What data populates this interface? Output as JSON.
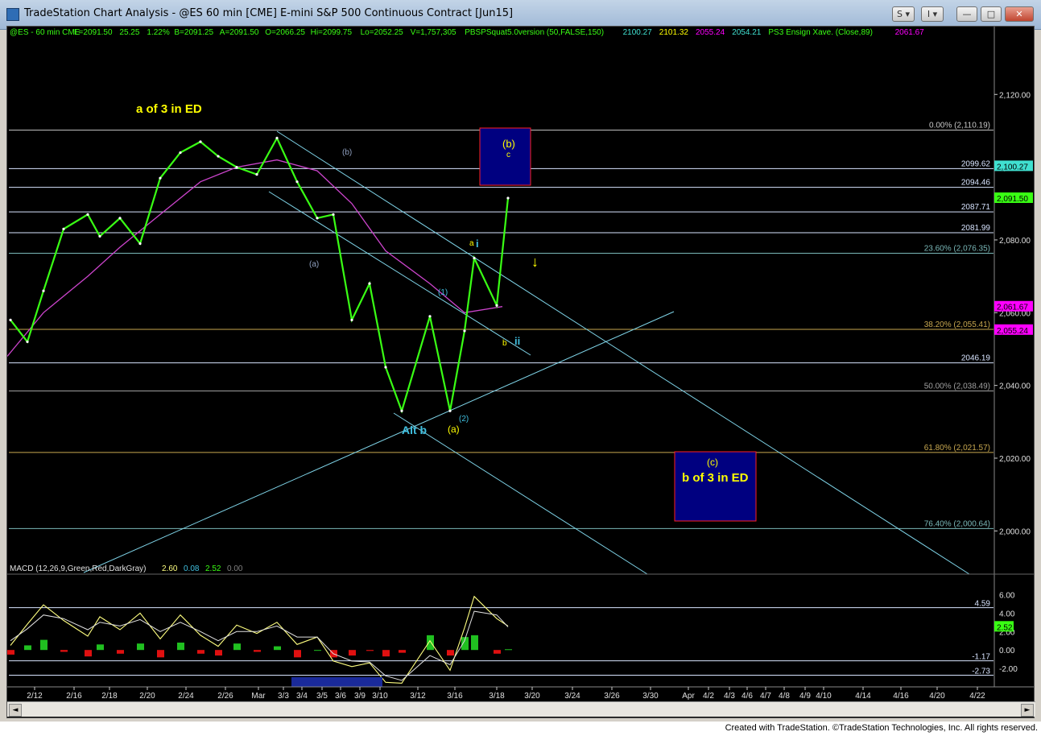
{
  "window": {
    "title": "TradeStation Chart Analysis - @ES 60 min [CME] E-mini S&P 500 Continuous Contract [Jun15]",
    "buttons": {
      "s": "S",
      "i": "I",
      "minimize": "—",
      "maximize": "□",
      "close": "✕"
    }
  },
  "header": {
    "symbol": "@ES - 60 min  CME",
    "items": [
      {
        "text": "L=2091.50",
        "color": "#39ff14"
      },
      {
        "text": "25.25",
        "color": "#39ff14"
      },
      {
        "text": "1.22%",
        "color": "#39ff14"
      },
      {
        "text": "B=2091.25",
        "color": "#39ff14"
      },
      {
        "text": "A=2091.50",
        "color": "#39ff14"
      },
      {
        "text": "O=2066.25",
        "color": "#39ff14"
      },
      {
        "text": "Hi=2099.75",
        "color": "#39ff14"
      },
      {
        "text": "Lo=2052.25",
        "color": "#39ff14"
      },
      {
        "text": "V=1,757,305",
        "color": "#39ff14"
      },
      {
        "text": "PBSPSquat5.0version (50,FALSE,150)",
        "color": "#39ff14"
      },
      {
        "text": "2100.27",
        "color": "#40e0d0"
      },
      {
        "text": "2101.32",
        "color": "#ffff00"
      },
      {
        "text": "2055.24",
        "color": "#ff00ff"
      },
      {
        "text": "2054.21",
        "color": "#40e0d0"
      },
      {
        "text": "PS3 Ensign Xave. (Close,89)",
        "color": "#39ff14"
      },
      {
        "text": "2061.67",
        "color": "#ff00ff"
      }
    ]
  },
  "chart_data": [
    {
      "type": "line",
      "title": "@ES 60 min E-mini S&P 500 Continuous Contract [Jun15]",
      "y_ticks": [
        2000,
        2020,
        2040,
        2060,
        2080,
        2100,
        2120
      ],
      "y_tick_labels": [
        "2,000.00",
        "2,020.00",
        "2,040.00",
        "2,060.00",
        "2,080.00",
        "2,100.00",
        "2,120.00"
      ],
      "ylim": [
        1989,
        2136
      ],
      "x_tick_labels": [
        "2/12",
        "2/16",
        "2/18",
        "2/20",
        "2/24",
        "2/26",
        "Mar",
        "3/3",
        "3/4",
        "3/5",
        "3/6",
        "3/9",
        "3/10",
        "3/12",
        "3/16",
        "3/18",
        "3/20",
        "3/24",
        "3/26",
        "3/30",
        "Apr",
        "4/2",
        "4/3",
        "4/6",
        "4/7",
        "4/8",
        "4/9",
        "4/10",
        "4/14",
        "4/16",
        "4/20",
        "4/22"
      ],
      "price_series": {
        "name": "@ES",
        "color": "#39ff14",
        "x": [
          "2/10",
          "2/11",
          "2/12",
          "2/13",
          "2/16",
          "2/17",
          "2/18",
          "2/19",
          "2/20",
          "2/23",
          "2/24",
          "2/25",
          "2/26",
          "2/27",
          "3/2",
          "3/3",
          "3/4",
          "3/5",
          "3/6",
          "3/9",
          "3/10",
          "3/11",
          "3/12",
          "3/13",
          "3/16",
          "3/17",
          "3/18",
          "3/18 close"
        ],
        "values": [
          2058,
          2052,
          2066,
          2083,
          2087,
          2081,
          2086,
          2079,
          2097,
          2104,
          2107,
          2103,
          2100,
          2098,
          2108,
          2096,
          2086,
          2087,
          2058,
          2068,
          2045,
          2033,
          2059,
          2033,
          2055,
          2075,
          2062,
          2091.5
        ]
      },
      "moving_average": {
        "name": "PS3 Ensign Xave. (Close,89)",
        "color": "#cc44cc",
        "x": [
          "2/10",
          "2/12",
          "2/16",
          "2/18",
          "2/20",
          "2/24",
          "2/26",
          "3/2",
          "3/4",
          "3/6",
          "3/10",
          "3/12",
          "3/16",
          "3/18"
        ],
        "values": [
          2048,
          2060,
          2070,
          2078,
          2087,
          2096,
          2100,
          2102,
          2099,
          2090,
          2077,
          2068,
          2060,
          2061.67
        ]
      },
      "horizontal_levels": [
        {
          "label": "0.00% (2,110.19)",
          "value": 2110.19,
          "color": "#c8c8c8"
        },
        {
          "label": "2099.62",
          "value": 2099.62,
          "color": "#d8e4ff"
        },
        {
          "label": "2094.46",
          "value": 2094.46,
          "color": "#d8e4ff"
        },
        {
          "label": "2087.71",
          "value": 2087.71,
          "color": "#d8e4ff"
        },
        {
          "label": "2081.99",
          "value": 2081.99,
          "color": "#d8e4ff"
        },
        {
          "label": "23.60% (2,076.35)",
          "value": 2076.35,
          "color": "#7ab8b8"
        },
        {
          "label": "38.20% (2,055.41)",
          "value": 2055.41,
          "color": "#c8a850"
        },
        {
          "label": "2046.19",
          "value": 2046.19,
          "color": "#d8e4ff"
        },
        {
          "label": "50.00% (2,038.49)",
          "value": 2038.49,
          "color": "#a0a0a0"
        },
        {
          "label": "61.80% (2,021.57)",
          "value": 2021.57,
          "color": "#c8a850"
        },
        {
          "label": "76.40% (2,000.64)",
          "value": 2000.64,
          "color": "#7ab8b8"
        }
      ],
      "price_tags": [
        {
          "text": "2,100.27",
          "value": 2100.27,
          "bg": "#40e0d0",
          "fg": "#000"
        },
        {
          "text": "2,091.50",
          "value": 2091.5,
          "bg": "#39ff14",
          "fg": "#000"
        },
        {
          "text": "2,061.67",
          "value": 2061.67,
          "bg": "#ff00ff",
          "fg": "#000"
        },
        {
          "text": "2,055.24",
          "value": 2055.24,
          "bg": "#ff00ff",
          "fg": "#000"
        }
      ],
      "annotations": [
        {
          "text": "a of 3 in ED",
          "color": "#ffff00"
        },
        {
          "text": "(b)",
          "color": "#8fa0c0"
        },
        {
          "text": "(a)",
          "color": "#8fa0c0"
        },
        {
          "text": "(1)",
          "color": "#40c0e0"
        },
        {
          "text": "(2)",
          "color": "#40c0e0"
        },
        {
          "text": "Alt b",
          "color": "#40c0e0"
        },
        {
          "text": "(a)",
          "color": "#ffff00"
        },
        {
          "text": "a",
          "color": "#ffff00"
        },
        {
          "text": "i",
          "color": "#40c0e0"
        },
        {
          "text": "b",
          "color": "#ffff00"
        },
        {
          "text": "ii",
          "color": "#40c0e0"
        },
        {
          "text": "(b)",
          "color": "#ffff00"
        },
        {
          "text": "c",
          "color": "#ffff00"
        },
        {
          "text": "(c)",
          "color": "#ffff00"
        },
        {
          "text": "b of 3 in ED",
          "color": "#ffff00"
        }
      ]
    },
    {
      "type": "line",
      "title": "MACD (12,26,9,Green,Red,DarkGray)",
      "legend_values": [
        {
          "text": "2.60",
          "color": "#ffff80"
        },
        {
          "text": "0.08",
          "color": "#40c0e0"
        },
        {
          "text": "2.52",
          "color": "#39ff14"
        },
        {
          "text": "0.00",
          "color": "#808080"
        }
      ],
      "y_ticks": [
        -2,
        0,
        2,
        4,
        6
      ],
      "y_tick_labels": [
        "-2.00",
        "0.00",
        "2.00",
        "4.00",
        "6.00"
      ],
      "ylim": [
        -4,
        7
      ],
      "levels": [
        {
          "label": "4.59",
          "value": 4.59
        },
        {
          "label": "-1.17",
          "value": -1.17
        },
        {
          "label": "-2.73",
          "value": -2.73
        }
      ],
      "last_tag": {
        "text": "2.52",
        "value": 2.52,
        "bg": "#39ff14"
      },
      "macd": [
        0.5,
        2.8,
        4.9,
        3.2,
        1.5,
        3.6,
        2.2,
        4.0,
        1.2,
        3.8,
        1.6,
        0.4,
        2.7,
        1.8,
        3.0,
        0.6,
        1.4,
        -1.2,
        -1.8,
        -1.4,
        -3.5,
        -3.6,
        1.0,
        -2.2,
        2.4,
        5.8,
        3.4,
        2.6
      ],
      "signal": [
        1.0,
        2.3,
        3.8,
        3.4,
        2.2,
        3.0,
        2.6,
        3.3,
        2.0,
        3.0,
        2.0,
        1.0,
        2.0,
        2.0,
        2.6,
        1.4,
        1.4,
        -0.4,
        -1.2,
        -1.3,
        -2.8,
        -3.3,
        -0.6,
        -1.6,
        1.0,
        4.2,
        3.8,
        2.5
      ],
      "histogram": [
        -0.5,
        0.5,
        1.1,
        -0.2,
        -0.7,
        0.6,
        -0.4,
        0.7,
        -0.8,
        0.8,
        -0.4,
        -0.6,
        0.7,
        -0.2,
        0.4,
        -0.8,
        0.0,
        -0.8,
        -0.6,
        -0.1,
        -0.7,
        -0.3,
        1.6,
        -0.6,
        1.4,
        1.6,
        -0.4,
        0.08
      ]
    }
  ],
  "footer": {
    "text": "Created with TradeStation. ©TradeStation Technologies, Inc. All rights reserved."
  }
}
